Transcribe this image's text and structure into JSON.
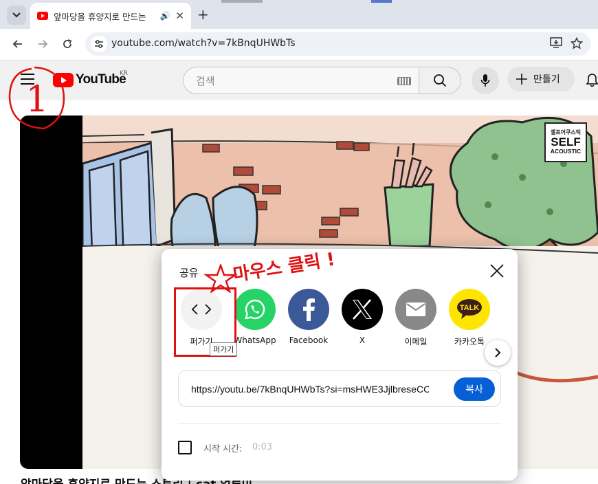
{
  "browser": {
    "tab_title": "앞마당을 휴양지로 만드는",
    "tab_audio_icon": "speaker-icon",
    "url": "youtube.com/watch?v=7kBnqUHWbTs"
  },
  "youtube": {
    "logo_text": "YouTube",
    "region": "KR",
    "search_placeholder": "검색",
    "create_label": "만들기"
  },
  "video": {
    "watermark_sub": "셀프어쿠스틱",
    "watermark_main": "SELF",
    "watermark_bottom": "ACOUSTIC",
    "title_below": "앞마당을 휴양지로 만드는 스토리 | cat 얼루미"
  },
  "share_dialog": {
    "title": "공유",
    "tooltip": "퍼가기",
    "options": [
      {
        "label": "퍼가기",
        "icon": "embed-icon",
        "color": "#f2f2f2"
      },
      {
        "label": "WhatsApp",
        "icon": "whatsapp-icon",
        "color": "#25d366"
      },
      {
        "label": "Facebook",
        "icon": "facebook-icon",
        "color": "#3b5998"
      },
      {
        "label": "X",
        "icon": "x-icon",
        "color": "#000000"
      },
      {
        "label": "이메일",
        "icon": "email-icon",
        "color": "#888888"
      },
      {
        "label": "카카오톡",
        "icon": "kakaotalk-icon",
        "color": "#fee500"
      }
    ],
    "kakao_badge": "TALK",
    "share_url": "https://youtu.be/7kBnqUHWbTs?si=msHWE3JjlbreseCC",
    "copy_label": "복사",
    "start_time_label": "시작 시간:",
    "start_time_value": "0:03"
  },
  "annotations": {
    "note": "마우스 클릭 !",
    "step": "1",
    "color": "#e01010"
  }
}
